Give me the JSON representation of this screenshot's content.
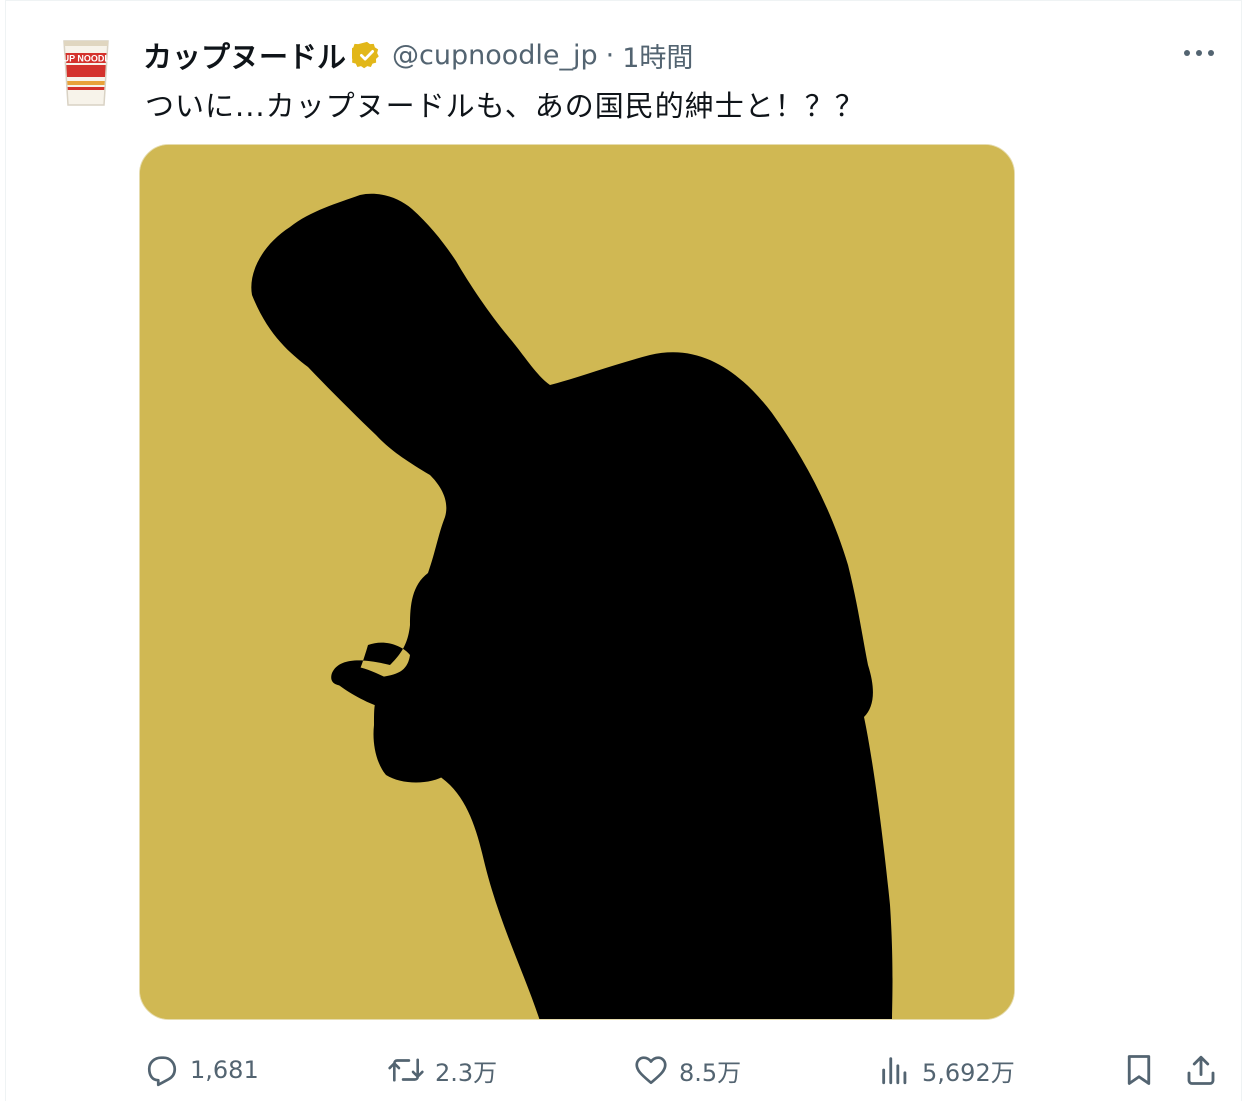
{
  "account": {
    "display_name": "カップヌードル",
    "verified_icon": "gold-verified-badge-icon",
    "handle": "@cupnoodle_jp",
    "separator": "·",
    "timestamp": "1時間",
    "avatar_icon": "cup-noodle-avatar",
    "avatar_logo_text": "CUP NOODLE"
  },
  "post": {
    "text": "ついに...カップヌードルも、あの国民的紳士と！？？",
    "media_icon": "silhouette-image",
    "media_background_color": "#d0b853"
  },
  "menu": {
    "more_icon": "more-horizontal-icon"
  },
  "actions": {
    "reply": {
      "icon": "reply-icon",
      "count": "1,681"
    },
    "repost": {
      "icon": "repost-icon",
      "count": "2.3万"
    },
    "like": {
      "icon": "heart-icon",
      "count": "8.5万"
    },
    "views": {
      "icon": "views-bar-icon",
      "count": "5,692万"
    },
    "bookmark": {
      "icon": "bookmark-icon"
    },
    "share": {
      "icon": "share-icon"
    }
  },
  "colors": {
    "text_primary": "#0f1419",
    "text_secondary": "#536471",
    "verified_gold": "#e2b719"
  }
}
